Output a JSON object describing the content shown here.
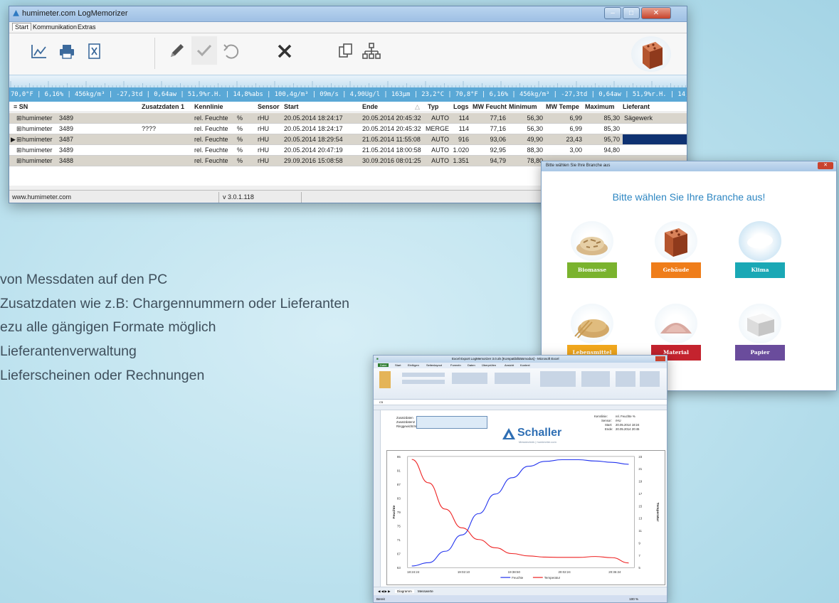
{
  "main_window": {
    "title": "humimeter.com LogMemorizer",
    "window_buttons": {
      "minimize": "–",
      "maximize": "□",
      "close": "✕"
    },
    "menu": [
      "Start",
      "Kommunikation",
      "Extras"
    ],
    "toolbar_icons": [
      "chart-icon",
      "print-icon",
      "excel-export-icon",
      "edit-icon",
      "confirm-icon",
      "undo-icon",
      "delete-icon",
      "copy-icon",
      "network-icon"
    ],
    "ticker": "70,0°F | 6,16% | 456kg/m³ | -27,3td | 0,64aw | 51,9%r.H. | 14,8%abs | 100,4g/m³ | 09m/s | 4,90Ug/l | 163µm | 23,2°C | 70,8°F | 6,16% | 456kg/m³ | -27,3td | 0,64aw | 51,9%r.H. | 14,8%abs | 10",
    "columns": [
      "SN",
      "Zusatzdaten 1",
      "Kennlinie",
      "Sensor",
      "Start",
      "Ende",
      "Typ",
      "Logs",
      "MW Feucht",
      "Minimum",
      "MW Tempe",
      "Maximum",
      "Lieferant"
    ],
    "rows": [
      {
        "device": "humimeter",
        "sn": "3489",
        "zusatz": "",
        "kennlinie": "rel. Feuchte",
        "unit": "%",
        "sensor": "rHU",
        "start": "20.05.2014 18:24:17",
        "ende": "20.05.2014 20:45:32",
        "typ": "AUTO",
        "logs": "114",
        "mw_feucht": "77,16",
        "minimum": "56,30",
        "mw_temp": "6,99",
        "maximum": "85,30",
        "lieferant": "Sägewerk"
      },
      {
        "device": "humimeter",
        "sn": "3489",
        "zusatz": "????",
        "kennlinie": "rel. Feuchte",
        "unit": "%",
        "sensor": "rHU",
        "start": "20.05.2014 18:24:17",
        "ende": "20.05.2014 20:45:32",
        "typ": "MERGE",
        "logs": "114",
        "mw_feucht": "77,16",
        "minimum": "56,30",
        "mw_temp": "6,99",
        "maximum": "85,30",
        "lieferant": ""
      },
      {
        "device": "humimeter",
        "sn": "3487",
        "zusatz": "",
        "kennlinie": "rel. Feuchte",
        "unit": "%",
        "sensor": "rHU",
        "start": "20.05.2014 18:29:54",
        "ende": "21.05.2014 11:55:08",
        "typ": "AUTO",
        "logs": "916",
        "mw_feucht": "93,06",
        "minimum": "49,90",
        "mw_temp": "23,43",
        "maximum": "95,70",
        "lieferant": ""
      },
      {
        "device": "humimeter",
        "sn": "3489",
        "zusatz": "",
        "kennlinie": "rel. Feuchte",
        "unit": "%",
        "sensor": "rHU",
        "start": "20.05.2014 20:47:19",
        "ende": "21.05.2014 18:00:58",
        "typ": "AUTO",
        "logs": "1.020",
        "mw_feucht": "92,95",
        "minimum": "88,30",
        "mw_temp": "3,00",
        "maximum": "94,80",
        "lieferant": ""
      },
      {
        "device": "humimeter",
        "sn": "3488",
        "zusatz": "",
        "kennlinie": "rel. Feuchte",
        "unit": "%",
        "sensor": "rHU",
        "start": "29.09.2016 15:08:58",
        "ende": "30.09.2016 08:01:25",
        "typ": "AUTO",
        "logs": "1.351",
        "mw_feucht": "94,79",
        "minimum": "78,80",
        "mw_temp": "",
        "maximum": "",
        "lieferant": ""
      }
    ],
    "status": {
      "url": "www.humimeter.com",
      "version": "v 3.0.1.118"
    }
  },
  "branch_dialog": {
    "title": "Bitte wählen Sie Ihre Branche aus",
    "close": "✕",
    "heading": "Bitte wählen Sie Ihre Branche aus!",
    "branches": [
      {
        "label": "Biomasse",
        "color": "#7ab32e"
      },
      {
        "label": "Gebäude",
        "color": "#ef7d1a"
      },
      {
        "label": "Klima",
        "color": "#1aa8b5"
      },
      {
        "label": "Lebensmittel",
        "color": "#f2a81d"
      },
      {
        "label": "Material",
        "color": "#c4232e"
      },
      {
        "label": "Papier",
        "color": "#6a4c9c"
      }
    ]
  },
  "excel_window": {
    "title": "Excel Export LogMemorizer 3.0.xls [Kompatibilitätsmodus] - Microsoft Excel",
    "ribbon_tabs": [
      "Datei",
      "Start",
      "Einfügen",
      "Seitenlayout",
      "Formeln",
      "Daten",
      "Überprüfen",
      "Ansicht",
      "Kontext"
    ],
    "cell_ref": "C5",
    "form_labels": [
      "Zusatzdaten",
      "Zusatzdaten2",
      "Ringgewicht/m²"
    ],
    "logo_brand": "Schaller",
    "logo_sub": "Messtechnik | humimeter.com",
    "info": [
      {
        "label": "Kennlinie:",
        "value": "rel. Feuchte    %"
      },
      {
        "label": "Sensor:",
        "value": "rHU"
      },
      {
        "label": "Start:",
        "value": "20.05.2014 18:24"
      },
      {
        "label": "Ende:",
        "value": "20.05.2014 20:45"
      }
    ],
    "sheet_tabs": [
      "Diagramm",
      "Messwerte"
    ],
    "status_left": "Bereit",
    "zoom": "100 %"
  },
  "chart_data": {
    "type": "line",
    "x": [
      "18:24:24",
      "",
      "19:02:10",
      "",
      "19:38:50",
      "",
      "20:02:24",
      "",
      "20:36:24",
      ""
    ],
    "xlabel": "",
    "ylabel": "Feuchte",
    "y2label": "Temperatur",
    "left_ticks": [
      "95",
      "91",
      "87",
      "83",
      "79",
      "75",
      "71",
      "67",
      "63"
    ],
    "right_ticks": [
      "23",
      "21",
      "19",
      "17",
      "15",
      "13",
      "11",
      "9",
      "7",
      "5"
    ],
    "ylim": [
      62,
      96
    ],
    "y2lim": [
      4,
      23
    ],
    "series": [
      {
        "name": "Feuchte",
        "color": "#2233ee",
        "axis": "left",
        "values": [
          62.5,
          63.5,
          67,
          72,
          78.5,
          84.5,
          89.5,
          93,
          94.5,
          95,
          95,
          94.6,
          94.2,
          93.6
        ]
      },
      {
        "name": "Temperatur",
        "color": "#ee2222",
        "axis": "right",
        "values": [
          22.5,
          18.5,
          14,
          10.8,
          8.8,
          7.4,
          6.4,
          6.0,
          5.8,
          5.75,
          5.75,
          5.9,
          5.7,
          4.8
        ]
      }
    ],
    "legend_position": "bottom"
  },
  "bullets": [
    "von Messdaten auf den PC",
    " Zusatzdaten wie z.B: Chargennummern oder Lieferanten",
    "ezu alle gängigen Formate möglich",
    "Lieferantenverwaltung",
    " Lieferscheinen oder Rechnungen"
  ]
}
